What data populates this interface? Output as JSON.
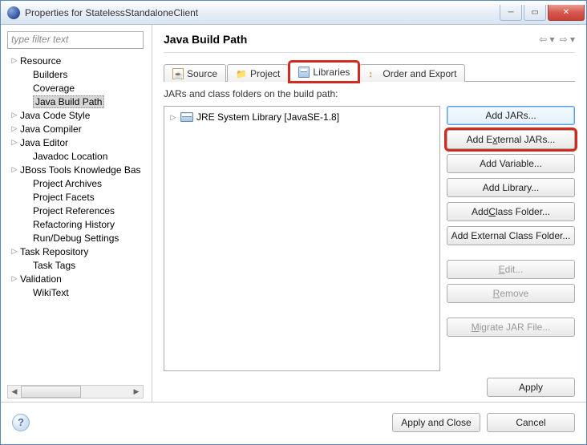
{
  "window": {
    "title": "Properties for StatelessStandaloneClient"
  },
  "filter_placeholder": "type filter text",
  "tree": [
    {
      "label": "Resource",
      "expandable": true,
      "depth": 0
    },
    {
      "label": "Builders",
      "expandable": false,
      "depth": 1
    },
    {
      "label": "Coverage",
      "expandable": false,
      "depth": 1
    },
    {
      "label": "Java Build Path",
      "expandable": false,
      "depth": 1,
      "selected": true
    },
    {
      "label": "Java Code Style",
      "expandable": true,
      "depth": 0
    },
    {
      "label": "Java Compiler",
      "expandable": true,
      "depth": 0
    },
    {
      "label": "Java Editor",
      "expandable": true,
      "depth": 0
    },
    {
      "label": "Javadoc Location",
      "expandable": false,
      "depth": 1
    },
    {
      "label": "JBoss Tools Knowledge Bas",
      "expandable": true,
      "depth": 0
    },
    {
      "label": "Project Archives",
      "expandable": false,
      "depth": 1
    },
    {
      "label": "Project Facets",
      "expandable": false,
      "depth": 1
    },
    {
      "label": "Project References",
      "expandable": false,
      "depth": 1
    },
    {
      "label": "Refactoring History",
      "expandable": false,
      "depth": 1
    },
    {
      "label": "Run/Debug Settings",
      "expandable": false,
      "depth": 1
    },
    {
      "label": "Task Repository",
      "expandable": true,
      "depth": 0
    },
    {
      "label": "Task Tags",
      "expandable": false,
      "depth": 1
    },
    {
      "label": "Validation",
      "expandable": true,
      "depth": 0
    },
    {
      "label": "WikiText",
      "expandable": false,
      "depth": 1
    }
  ],
  "page": {
    "title": "Java Build Path",
    "subtitle": "JARs and class folders on the build path:"
  },
  "tabs": {
    "source": "Source",
    "projects": "Project",
    "libraries": "Libraries",
    "order": "Order and Export"
  },
  "jars": [
    {
      "label": "JRE System Library [JavaSE-1.8]"
    }
  ],
  "buttons": {
    "add_jars": "Add JARs...",
    "add_external_jars_pre": "Add E",
    "add_external_jars_ul": "x",
    "add_external_jars_post": "ternal JARs...",
    "add_variable": "Add Variable...",
    "add_library": "Add Library...",
    "add_class_folder_pre": "Add ",
    "add_class_folder_ul": "C",
    "add_class_folder_post": "lass Folder...",
    "add_ext_class_folder": "Add External Class Folder...",
    "edit_ul": "E",
    "edit_post": "dit...",
    "remove_ul": "R",
    "remove_post": "emove",
    "migrate_ul": "M",
    "migrate_post": "igrate JAR File...",
    "apply": "Apply",
    "apply_close": "Apply and Close",
    "cancel": "Cancel"
  }
}
